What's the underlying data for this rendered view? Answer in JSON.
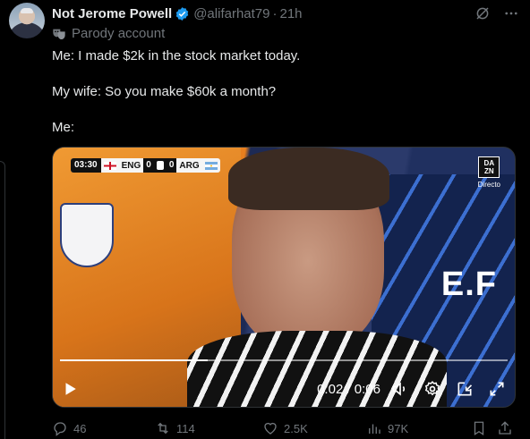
{
  "tweet": {
    "author": {
      "name": "Not Jerome Powell",
      "handle": "@alifarhat79",
      "separator": "·",
      "time": "21h",
      "label": "Parody account"
    },
    "text": [
      "Me: I made $2k in the stock market today.",
      "My wife: So you make $60k a month?",
      "Me:"
    ],
    "media": {
      "scorebug": {
        "clock": "03:30",
        "home": "ENG",
        "home_score": "0",
        "away_score": "0",
        "away": "ARG"
      },
      "broadcaster": {
        "top": "DA",
        "bottom": "ZN",
        "status": "Directo"
      },
      "jersey_text": "E.F",
      "time_display": "0:02 / 0:06",
      "progress": 0.33
    },
    "actions": {
      "replies": "46",
      "reposts": "114",
      "likes": "2.5K",
      "views": "97K"
    }
  },
  "colors": {
    "background": "#000000",
    "text": "#e7e9ea",
    "muted": "#71767b",
    "verified": "#1d9bf0"
  }
}
